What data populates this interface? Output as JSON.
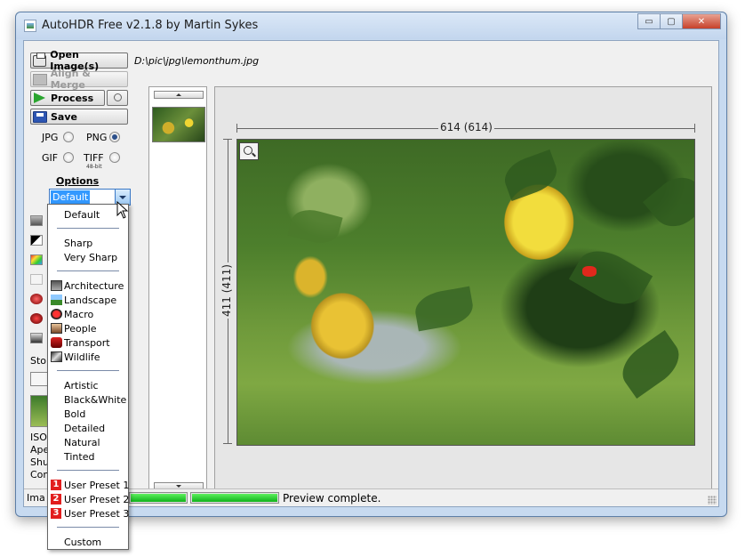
{
  "window": {
    "title": "AutoHDR Free v2.1.8 by Martin Sykes",
    "min_glyph": "▭",
    "max_glyph": "▢",
    "close_glyph": "✕"
  },
  "toolbar": {
    "open_label": "Open Image(s)",
    "align_label": "Align & Merge",
    "process_label": "Process",
    "save_label": "Save"
  },
  "file_path": "D:\\pic\\jpg\\lemonthum.jpg",
  "formats": {
    "jpg": "JPG",
    "png": "PNG",
    "gif": "GIF",
    "tiff": "TIFF",
    "tiff_note": "48-bit",
    "selected": "PNG"
  },
  "options": {
    "heading": "Options",
    "selected": "Default"
  },
  "dropdown": {
    "default": "Default",
    "sharp": "Sharp",
    "very_sharp": "Very Sharp",
    "architecture": "Architecture",
    "landscape": "Landscape",
    "macro": "Macro",
    "people": "People",
    "transport": "Transport",
    "wildlife": "Wildlife",
    "artistic": "Artistic",
    "black_white": "Black&White",
    "bold": "Bold",
    "detailed": "Detailed",
    "natural": "Natural",
    "tinted": "Tinted",
    "user_preset_1": "User Preset 1",
    "user_preset_2": "User Preset 2",
    "user_preset_3": "User Preset 3",
    "badge_1": "1",
    "badge_2": "2",
    "badge_3": "3",
    "custom": "Custom"
  },
  "left_clipped": {
    "store": "Stor",
    "iso": "ISO",
    "aperture": "Aper",
    "shutter": "Shut",
    "comp": "Com"
  },
  "preview": {
    "width_label": "614 (614)",
    "height_label": "411 (411)"
  },
  "status": {
    "left_text": "Ima",
    "message": "Preview complete.",
    "progress_1": 1.0,
    "progress_2": 1.0
  },
  "colors": {
    "accent": "#3399ff",
    "progress": "#0fb21a",
    "preset_badge": "#e21e1e"
  }
}
